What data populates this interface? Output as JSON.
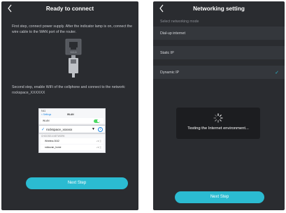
{
  "left_screen": {
    "title": "Ready to connect",
    "step1": "First step, connect power supply. After the indicator lamp is on, connect the wire cable to the WAN port of the router.",
    "wan_label": "WAN",
    "step2": "Second step, enable WiFi of the cellphone and connect to the network: rockspace_XXXXXX",
    "phone_shot": {
      "settings_back": "< Settings",
      "header": "WLAN",
      "wlan_row": "WLAN",
      "selected_network": "rockspace_xxxxxx",
      "section": "CHOOSE A NETWORK",
      "networks": [
        {
          "name": "Wireless 3042",
          "signal": "• ▾ ⓘ"
        },
        {
          "name": "rokkuvan_home",
          "signal": "• ▾ ⓘ"
        }
      ]
    },
    "next_button": "Next Step"
  },
  "right_screen": {
    "title": "Networking setting",
    "section_label": "Select networking mode",
    "options": [
      {
        "label": "Dial-up internet"
      },
      {
        "label": "Static IP"
      },
      {
        "label": "Dynamic IP",
        "selected": true
      }
    ],
    "toast": "Testing the Internet environment...",
    "next_button": "Next Step"
  },
  "colors": {
    "background": "#2a2c30",
    "accent": "#2bbbd1",
    "check": "#2bbbd1"
  },
  "icons": [
    "back-icon",
    "router-icon",
    "wifi-icon",
    "info-icon",
    "checkmark-icon",
    "spinner-icon"
  ]
}
